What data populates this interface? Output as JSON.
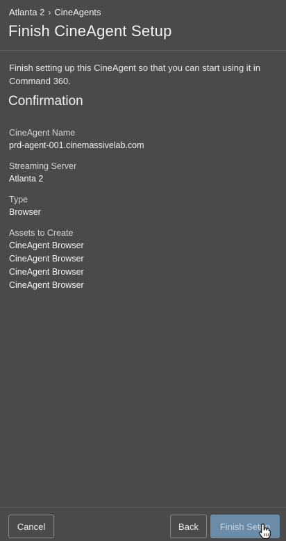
{
  "breadcrumb": {
    "parent": "Atlanta 2",
    "separator": "›",
    "current": "CineAgents"
  },
  "page_title": "Finish CineAgent Setup",
  "intro_text": "Finish setting up this CineAgent so that you can start using it in Command 360.",
  "confirmation": {
    "title": "Confirmation",
    "agent_name": {
      "label": "CineAgent Name",
      "value": "prd-agent-001.cinemassivelab.com"
    },
    "streaming_server": {
      "label": "Streaming Server",
      "value": "Atlanta 2"
    },
    "type": {
      "label": "Type",
      "value": "Browser"
    },
    "assets": {
      "label": "Assets to Create",
      "items": [
        "CineAgent Browser",
        "CineAgent Browser",
        "CineAgent Browser",
        "CineAgent Browser"
      ]
    }
  },
  "footer": {
    "cancel_label": "Cancel",
    "back_label": "Back",
    "finish_label": "Finish Setup"
  },
  "colors": {
    "background": "#4a4a4a",
    "primary_button": "#6c8ba6",
    "text": "#f0f0f0"
  }
}
